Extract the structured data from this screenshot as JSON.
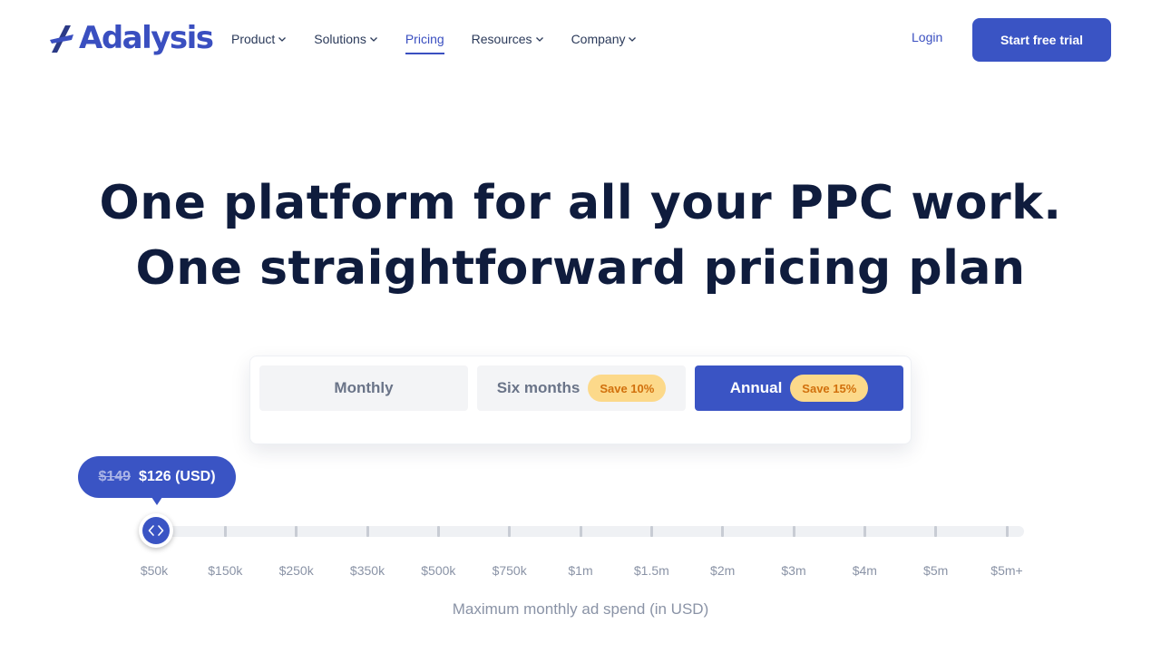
{
  "brand": {
    "name": "Adalysis",
    "color": "#3a4fc0",
    "logo_icon": "logo-mark-icon"
  },
  "nav": {
    "items": [
      {
        "label": "Product",
        "has_dropdown": true,
        "active": false
      },
      {
        "label": "Solutions",
        "has_dropdown": true,
        "active": false
      },
      {
        "label": "Pricing",
        "has_dropdown": false,
        "active": true
      },
      {
        "label": "Resources",
        "has_dropdown": true,
        "active": false
      },
      {
        "label": "Company",
        "has_dropdown": true,
        "active": false
      }
    ],
    "login_label": "Login",
    "cta_label": "Start free trial"
  },
  "hero": {
    "line1": "One platform for all your PPC work.",
    "line2": "One straightforward pricing plan"
  },
  "billing": {
    "options": [
      {
        "label": "Monthly",
        "badge": "",
        "selected": false
      },
      {
        "label": "Six months",
        "badge": "Save 10%",
        "selected": false
      },
      {
        "label": "Annual",
        "badge": "Save 15%",
        "selected": true
      }
    ]
  },
  "price": {
    "old": "$149",
    "current": "$126 (USD)"
  },
  "slider": {
    "ticks": [
      "$50k",
      "$150k",
      "$250k",
      "$350k",
      "$500k",
      "$750k",
      "$1m",
      "$1.5m",
      "$2m",
      "$3m",
      "$4m",
      "$5m",
      "$5m+"
    ],
    "selected_index": 0,
    "caption": "Maximum monthly ad spend (in USD)",
    "thumb_icon": "left-right-arrows-icon"
  },
  "colors": {
    "primary": "#3a54c4",
    "heading": "#0f1c3d",
    "badge_bg": "#fcd98a",
    "badge_text": "#d1700c"
  }
}
